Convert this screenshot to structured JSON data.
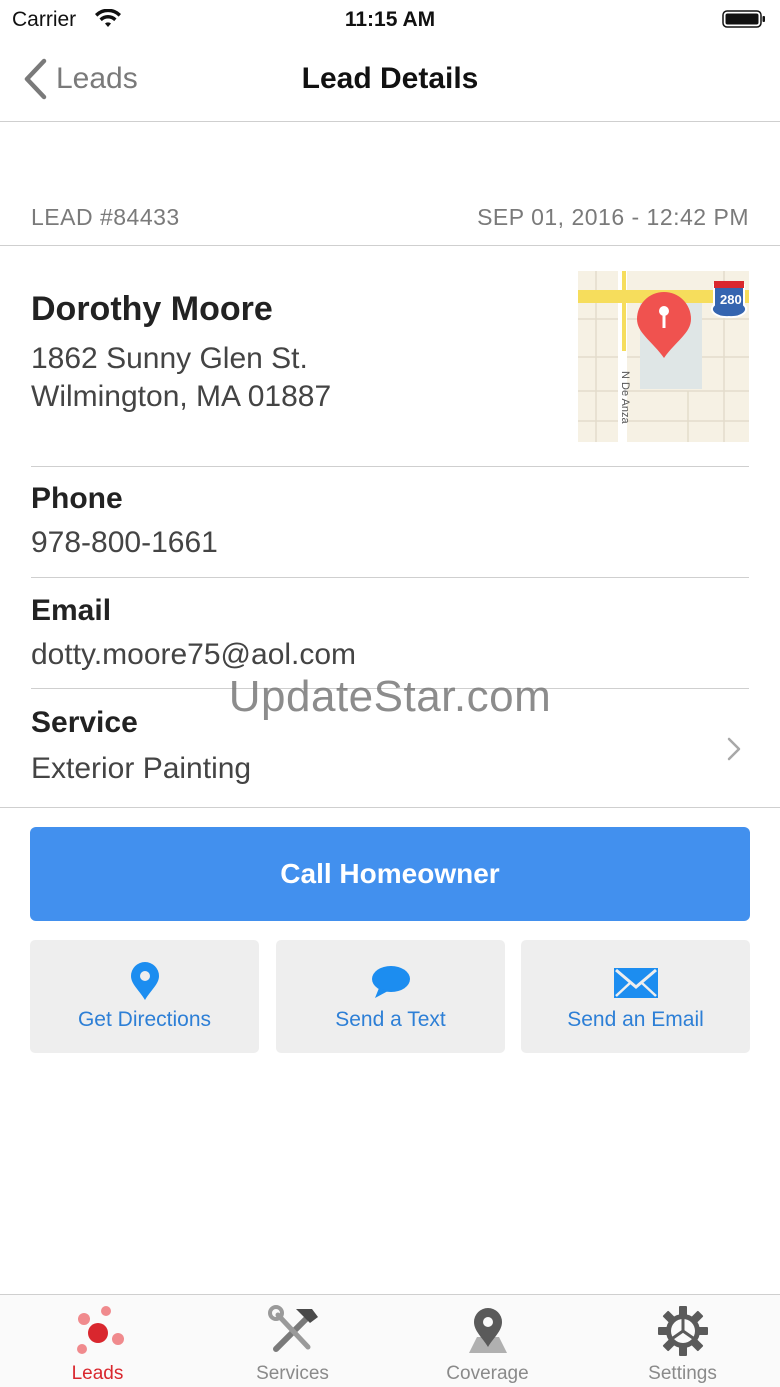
{
  "status_bar": {
    "carrier": "Carrier",
    "time": "11:15 AM"
  },
  "nav": {
    "back_label": "Leads",
    "title": "Lead Details"
  },
  "lead": {
    "number": "LEAD #84433",
    "date": "SEP 01, 2016 - 12:42 PM"
  },
  "contact": {
    "name": "Dorothy Moore",
    "address_line1": "1862 Sunny Glen St.",
    "address_line2": "Wilmington, MA 01887"
  },
  "map": {
    "street_label": "N De Anza",
    "highway_label": "280"
  },
  "fields": {
    "phone_label": "Phone",
    "phone_value": "978-800-1661",
    "email_label": "Email",
    "email_value": "dotty.moore75@aol.com",
    "service_label": "Service",
    "service_value": "Exterior Painting"
  },
  "watermark": "UpdateStar.com",
  "actions": {
    "call": "Call Homeowner",
    "directions": "Get Directions",
    "text": "Send a Text",
    "email": "Send an Email"
  },
  "tabs": [
    {
      "label": "Leads",
      "icon": "leads-icon"
    },
    {
      "label": "Services",
      "icon": "hammer-wrench-icon"
    },
    {
      "label": "Coverage",
      "icon": "map-pin-icon"
    },
    {
      "label": "Settings",
      "icon": "gear-icon"
    }
  ],
  "colors": {
    "accent": "#4290ee",
    "link": "#2d7fd6",
    "active_tab": "#d9272e",
    "map_pin": "#f0524f"
  }
}
